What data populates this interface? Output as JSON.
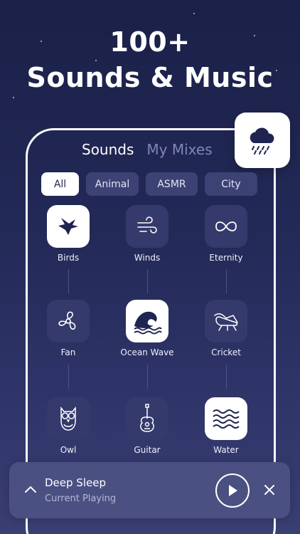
{
  "headline": {
    "line1": "100+",
    "line2": "Sounds & Music"
  },
  "tabs": [
    {
      "label": "Sounds"
    },
    {
      "label": "My Mixes"
    }
  ],
  "chips": [
    {
      "label": "All"
    },
    {
      "label": "Animal"
    },
    {
      "label": "ASMR"
    },
    {
      "label": "City"
    }
  ],
  "sounds": [
    {
      "label": "Birds",
      "icon": "bird-icon",
      "selected": true
    },
    {
      "label": "Winds",
      "icon": "wind-icon",
      "selected": false
    },
    {
      "label": "Eternity",
      "icon": "infinity-icon",
      "selected": false
    },
    {
      "label": "Fan",
      "icon": "fan-icon",
      "selected": false
    },
    {
      "label": "Ocean Wave",
      "icon": "wave-icon",
      "selected": true
    },
    {
      "label": "Cricket",
      "icon": "cricket-icon",
      "selected": false
    },
    {
      "label": "Owl",
      "icon": "owl-icon",
      "selected": false
    },
    {
      "label": "Guitar",
      "icon": "guitar-icon",
      "selected": false
    },
    {
      "label": "Water",
      "icon": "water-icon",
      "selected": true
    }
  ],
  "player": {
    "title": "Deep Sleep",
    "subtitle": "Current Playing"
  },
  "colors": {
    "accent_dark": "#1f2550",
    "tile": "#343a6b",
    "player_bg": "#4a5081"
  }
}
